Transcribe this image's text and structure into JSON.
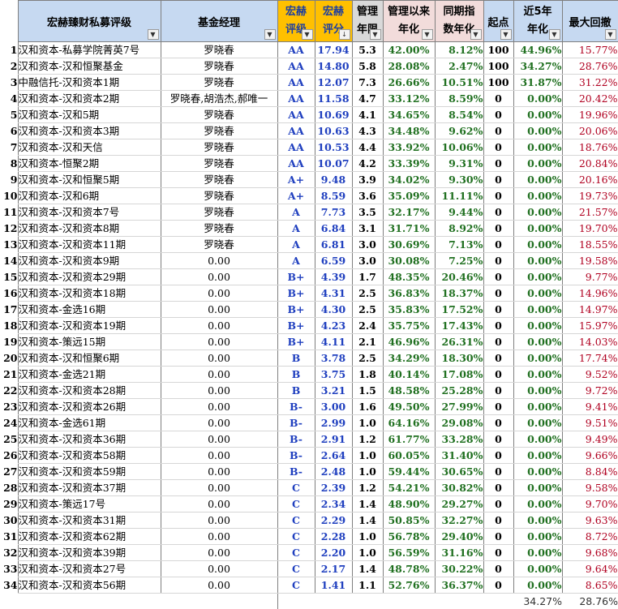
{
  "headers": {
    "name": "宏赫臻财私募评级",
    "manager": "基金经理",
    "rating_l1": "宏赫",
    "rating_l2": "评级",
    "score_l1": "宏赫",
    "score_l2": "评分",
    "years_l1": "管理",
    "years_l2": "年限",
    "ann_l1": "管理以来",
    "ann_l2": "年化",
    "idx_l1": "同期指",
    "idx_l2": "数年化",
    "start": "起点",
    "y5_l1": "近5年",
    "y5_l2": "年化",
    "dd": "最大回撤"
  },
  "filter_icon": "dropdown-arrow",
  "sort_icon": "sort-desc-arrow",
  "rows": [
    {
      "n": "1",
      "name": "汉和资本-私募学院菁英7号",
      "mgr": "罗晓春",
      "rating": "AA",
      "score": "17.94",
      "years": "5.3",
      "ann": "42.00%",
      "idx": "8.12%",
      "start": "100",
      "y5": "44.96%",
      "dd": "15.77%"
    },
    {
      "n": "2",
      "name": "汉和资本-汉和恒聚基金",
      "mgr": "罗晓春",
      "rating": "AA",
      "score": "14.80",
      "years": "5.8",
      "ann": "28.08%",
      "idx": "2.47%",
      "start": "100",
      "y5": "34.27%",
      "dd": "28.76%"
    },
    {
      "n": "3",
      "name": "中融信托-汉和资本1期",
      "mgr": "罗晓春",
      "rating": "AA",
      "score": "12.07",
      "years": "7.3",
      "ann": "26.66%",
      "idx": "10.51%",
      "start": "100",
      "y5": "31.87%",
      "dd": "31.22%"
    },
    {
      "n": "4",
      "name": "汉和资本-汉和资本2期",
      "mgr": "罗晓春,胡浩杰,郝唯一",
      "rating": "AA",
      "score": "11.58",
      "years": "4.7",
      "ann": "33.12%",
      "idx": "8.59%",
      "start": "0",
      "y5": "0.00%",
      "dd": "20.42%"
    },
    {
      "n": "5",
      "name": "汉和资本-汉和5期",
      "mgr": "罗晓春",
      "rating": "AA",
      "score": "10.69",
      "years": "4.1",
      "ann": "34.65%",
      "idx": "8.54%",
      "start": "0",
      "y5": "0.00%",
      "dd": "19.96%"
    },
    {
      "n": "6",
      "name": "汉和资本-汉和资本3期",
      "mgr": "罗晓春",
      "rating": "AA",
      "score": "10.63",
      "years": "4.3",
      "ann": "34.48%",
      "idx": "9.62%",
      "start": "0",
      "y5": "0.00%",
      "dd": "20.06%"
    },
    {
      "n": "7",
      "name": "汉和资本-汉和天信",
      "mgr": "罗晓春",
      "rating": "AA",
      "score": "10.53",
      "years": "4.4",
      "ann": "33.92%",
      "idx": "10.06%",
      "start": "0",
      "y5": "0.00%",
      "dd": "18.76%"
    },
    {
      "n": "8",
      "name": "汉和资本-恒聚2期",
      "mgr": "罗晓春",
      "rating": "AA",
      "score": "10.07",
      "years": "4.2",
      "ann": "33.39%",
      "idx": "9.31%",
      "start": "0",
      "y5": "0.00%",
      "dd": "20.84%"
    },
    {
      "n": "9",
      "name": "汉和资本-汉和恒聚5期",
      "mgr": "罗晓春",
      "rating": "A+",
      "score": "9.48",
      "years": "3.9",
      "ann": "34.02%",
      "idx": "9.30%",
      "start": "0",
      "y5": "0.00%",
      "dd": "20.16%"
    },
    {
      "n": "10",
      "name": "汉和资本-汉和6期",
      "mgr": "罗晓春",
      "rating": "A+",
      "score": "8.59",
      "years": "3.6",
      "ann": "35.09%",
      "idx": "11.11%",
      "start": "0",
      "y5": "0.00%",
      "dd": "19.73%"
    },
    {
      "n": "11",
      "name": "汉和资本-汉和资本7号",
      "mgr": "罗晓春",
      "rating": "A",
      "score": "7.73",
      "years": "3.5",
      "ann": "32.17%",
      "idx": "9.44%",
      "start": "0",
      "y5": "0.00%",
      "dd": "21.57%"
    },
    {
      "n": "12",
      "name": "汉和资本-汉和资本8期",
      "mgr": "罗晓春",
      "rating": "A",
      "score": "6.84",
      "years": "3.1",
      "ann": "31.71%",
      "idx": "8.92%",
      "start": "0",
      "y5": "0.00%",
      "dd": "19.70%"
    },
    {
      "n": "13",
      "name": "汉和资本-汉和资本11期",
      "mgr": "罗晓春",
      "rating": "A",
      "score": "6.81",
      "years": "3.0",
      "ann": "30.69%",
      "idx": "7.13%",
      "start": "0",
      "y5": "0.00%",
      "dd": "18.55%"
    },
    {
      "n": "14",
      "name": "汉和资本-汉和资本9期",
      "mgr": "0.00",
      "rating": "A",
      "score": "6.59",
      "years": "3.0",
      "ann": "30.08%",
      "idx": "7.25%",
      "start": "0",
      "y5": "0.00%",
      "dd": "19.58%"
    },
    {
      "n": "15",
      "name": "汉和资本-汉和资本29期",
      "mgr": "0.00",
      "rating": "B+",
      "score": "4.39",
      "years": "1.7",
      "ann": "48.35%",
      "idx": "20.46%",
      "start": "0",
      "y5": "0.00%",
      "dd": "9.77%"
    },
    {
      "n": "16",
      "name": "汉和资本-汉和资本18期",
      "mgr": "0.00",
      "rating": "B+",
      "score": "4.31",
      "years": "2.5",
      "ann": "36.83%",
      "idx": "18.37%",
      "start": "0",
      "y5": "0.00%",
      "dd": "14.96%"
    },
    {
      "n": "17",
      "name": "汉和资本-金选16期",
      "mgr": "0.00",
      "rating": "B+",
      "score": "4.30",
      "years": "2.5",
      "ann": "35.83%",
      "idx": "17.52%",
      "start": "0",
      "y5": "0.00%",
      "dd": "14.97%"
    },
    {
      "n": "18",
      "name": "汉和资本-汉和资本19期",
      "mgr": "0.00",
      "rating": "B+",
      "score": "4.23",
      "years": "2.4",
      "ann": "35.75%",
      "idx": "17.43%",
      "start": "0",
      "y5": "0.00%",
      "dd": "15.97%"
    },
    {
      "n": "19",
      "name": "汉和资本-策远15期",
      "mgr": "0.00",
      "rating": "B+",
      "score": "4.11",
      "years": "2.1",
      "ann": "46.96%",
      "idx": "26.31%",
      "start": "0",
      "y5": "0.00%",
      "dd": "14.03%"
    },
    {
      "n": "20",
      "name": "汉和资本-汉和恒聚6期",
      "mgr": "0.00",
      "rating": "B",
      "score": "3.78",
      "years": "2.5",
      "ann": "34.29%",
      "idx": "18.30%",
      "start": "0",
      "y5": "0.00%",
      "dd": "17.74%"
    },
    {
      "n": "21",
      "name": "汉和资本-金选21期",
      "mgr": "0.00",
      "rating": "B",
      "score": "3.75",
      "years": "1.8",
      "ann": "40.14%",
      "idx": "17.08%",
      "start": "0",
      "y5": "0.00%",
      "dd": "9.52%"
    },
    {
      "n": "22",
      "name": "汉和资本-汉和资本28期",
      "mgr": "0.00",
      "rating": "B",
      "score": "3.21",
      "years": "1.5",
      "ann": "48.58%",
      "idx": "25.28%",
      "start": "0",
      "y5": "0.00%",
      "dd": "9.72%"
    },
    {
      "n": "23",
      "name": "汉和资本-汉和资本26期",
      "mgr": "0.00",
      "rating": "B-",
      "score": "3.00",
      "years": "1.6",
      "ann": "49.50%",
      "idx": "27.99%",
      "start": "0",
      "y5": "0.00%",
      "dd": "9.41%"
    },
    {
      "n": "24",
      "name": "汉和资本-金选61期",
      "mgr": "0.00",
      "rating": "B-",
      "score": "2.99",
      "years": "1.0",
      "ann": "64.16%",
      "idx": "29.08%",
      "start": "0",
      "y5": "0.00%",
      "dd": "9.51%"
    },
    {
      "n": "25",
      "name": "汉和资本-汉和资本36期",
      "mgr": "0.00",
      "rating": "B-",
      "score": "2.91",
      "years": "1.2",
      "ann": "61.77%",
      "idx": "33.28%",
      "start": "0",
      "y5": "0.00%",
      "dd": "9.49%"
    },
    {
      "n": "26",
      "name": "汉和资本-汉和资本58期",
      "mgr": "0.00",
      "rating": "B-",
      "score": "2.64",
      "years": "1.0",
      "ann": "60.05%",
      "idx": "31.40%",
      "start": "0",
      "y5": "0.00%",
      "dd": "9.66%"
    },
    {
      "n": "27",
      "name": "汉和资本-汉和资本59期",
      "mgr": "0.00",
      "rating": "B-",
      "score": "2.48",
      "years": "1.0",
      "ann": "59.44%",
      "idx": "30.65%",
      "start": "0",
      "y5": "0.00%",
      "dd": "8.84%"
    },
    {
      "n": "28",
      "name": "汉和资本-汉和资本37期",
      "mgr": "0.00",
      "rating": "C",
      "score": "2.39",
      "years": "1.2",
      "ann": "54.21%",
      "idx": "30.82%",
      "start": "0",
      "y5": "0.00%",
      "dd": "9.58%"
    },
    {
      "n": "29",
      "name": "汉和资本-策远17号",
      "mgr": "0.00",
      "rating": "C",
      "score": "2.34",
      "years": "1.4",
      "ann": "48.90%",
      "idx": "29.27%",
      "start": "0",
      "y5": "0.00%",
      "dd": "9.70%"
    },
    {
      "n": "30",
      "name": "汉和资本-汉和资本31期",
      "mgr": "0.00",
      "rating": "C",
      "score": "2.29",
      "years": "1.4",
      "ann": "50.85%",
      "idx": "32.27%",
      "start": "0",
      "y5": "0.00%",
      "dd": "9.63%"
    },
    {
      "n": "31",
      "name": "汉和资本-汉和资本62期",
      "mgr": "0.00",
      "rating": "C",
      "score": "2.28",
      "years": "1.0",
      "ann": "56.78%",
      "idx": "29.40%",
      "start": "0",
      "y5": "0.00%",
      "dd": "8.72%"
    },
    {
      "n": "32",
      "name": "汉和资本-汉和资本39期",
      "mgr": "0.00",
      "rating": "C",
      "score": "2.20",
      "years": "1.0",
      "ann": "56.59%",
      "idx": "31.16%",
      "start": "0",
      "y5": "0.00%",
      "dd": "9.68%"
    },
    {
      "n": "33",
      "name": "汉和资本-汉和资本27号",
      "mgr": "0.00",
      "rating": "C",
      "score": "2.17",
      "years": "1.4",
      "ann": "48.78%",
      "idx": "30.22%",
      "start": "0",
      "y5": "0.00%",
      "dd": "9.64%"
    },
    {
      "n": "34",
      "name": "汉和资本-汉和资本56期",
      "mgr": "0.00",
      "rating": "C",
      "score": "1.41",
      "years": "1.1",
      "ann": "52.76%",
      "idx": "36.37%",
      "start": "0",
      "y5": "0.00%",
      "dd": "8.65%"
    }
  ],
  "summary": {
    "y5": "34.27%",
    "dd": "28.76%"
  }
}
